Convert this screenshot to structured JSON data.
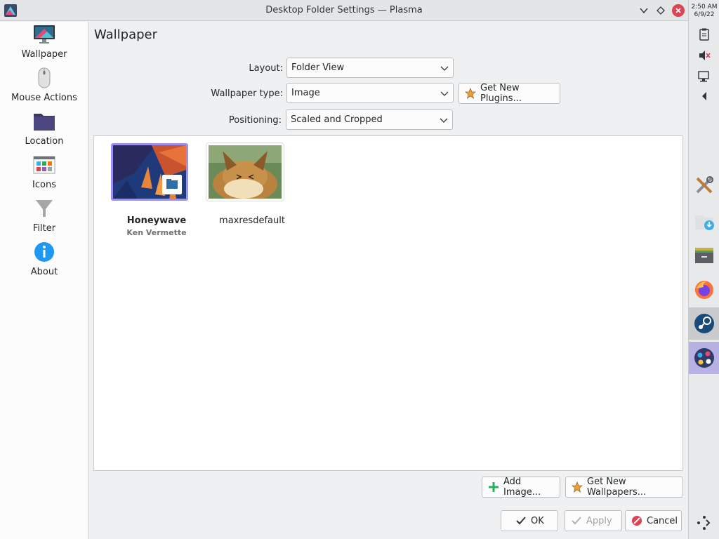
{
  "window": {
    "title": "Desktop Folder Settings — Plasma"
  },
  "sidebar": {
    "items": [
      {
        "label": "Wallpaper",
        "icon": "monitor-icon"
      },
      {
        "label": "Mouse Actions",
        "icon": "mouse-icon"
      },
      {
        "label": "Location",
        "icon": "folder-icon"
      },
      {
        "label": "Icons",
        "icon": "icons-grid-icon"
      },
      {
        "label": "Filter",
        "icon": "filter-icon"
      },
      {
        "label": "About",
        "icon": "info-icon"
      }
    ]
  },
  "page": {
    "title": "Wallpaper"
  },
  "form": {
    "layout_label": "Layout:",
    "layout_value": "Folder View",
    "wallpaper_type_label": "Wallpaper type:",
    "wallpaper_type_value": "Image",
    "get_new_plugins_label": "Get New Plugins...",
    "positioning_label": "Positioning:",
    "positioning_value": "Scaled and Cropped"
  },
  "wallpapers": [
    {
      "name": "Honeywave",
      "author": "Ken Vermette",
      "selected": true
    },
    {
      "name": "maxresdefault",
      "author": "",
      "selected": false
    }
  ],
  "actions": {
    "add_image_label": "Add Image...",
    "get_new_wallpapers_label": "Get New Wallpapers...",
    "ok_label": "OK",
    "apply_label": "Apply",
    "cancel_label": "Cancel"
  },
  "panel": {
    "time": "2:50 AM",
    "date": "6/9/22",
    "tray_icons": [
      "clipboard-icon",
      "volume-muted-icon",
      "display-icon",
      "expand-arrow-icon"
    ],
    "tasks": [
      "system-tools-icon",
      "downloads-icon",
      "archive-icon",
      "firefox-icon",
      "steam-icon",
      "game-launcher-icon"
    ],
    "menu_icon": "app-launcher-icon"
  },
  "colors": {
    "accent": "#3daee9",
    "selection": "#9b8ff0",
    "close": "#da4453"
  }
}
